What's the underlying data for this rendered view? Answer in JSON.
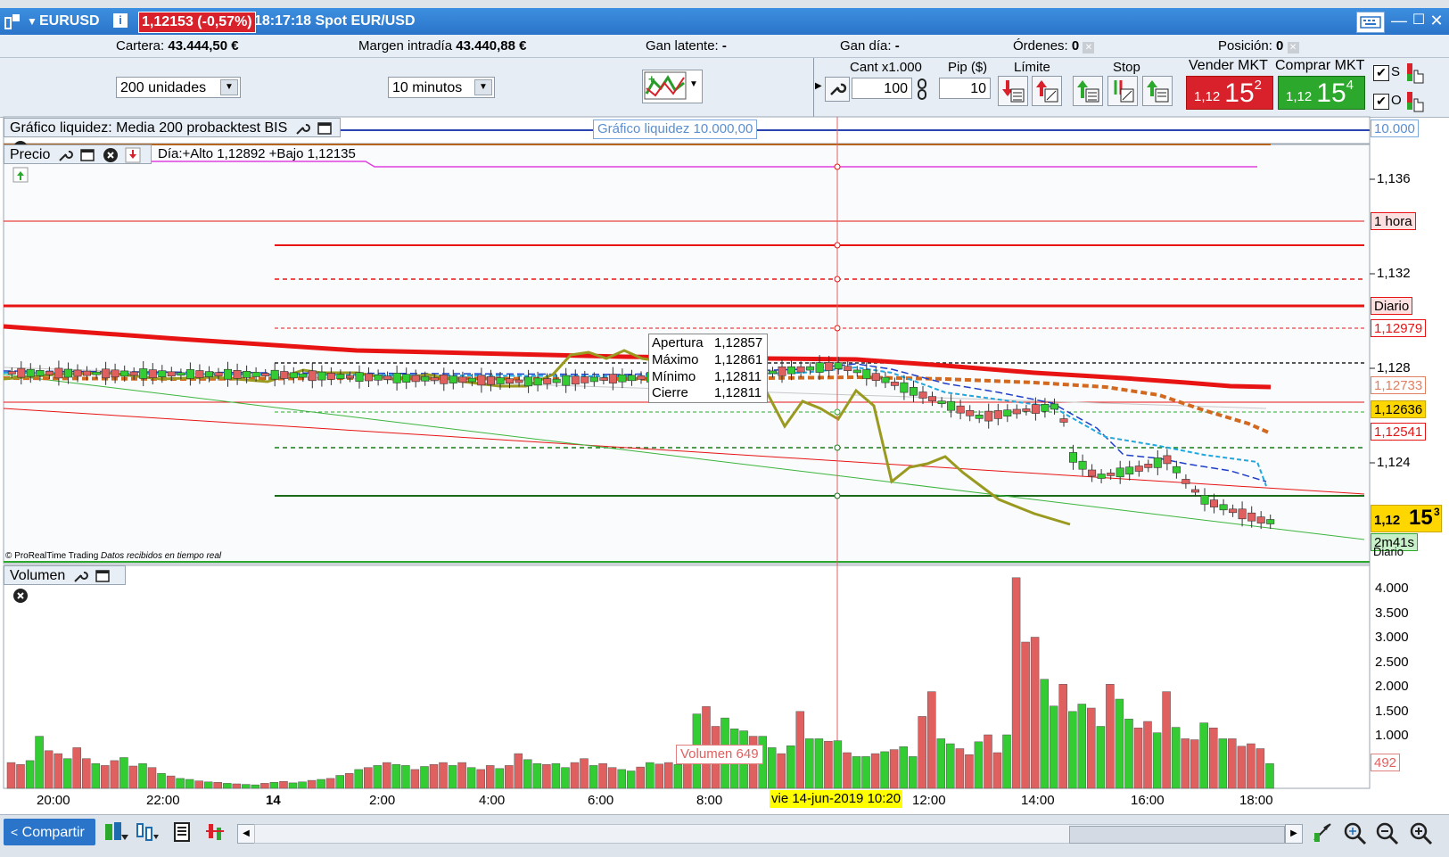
{
  "title_bar": {
    "symbol": "EURUSD",
    "info_icon": "i",
    "price_change": "1,12153 (-0,57%)",
    "time_info": "18:17:18 Spot EUR/USD"
  },
  "account": {
    "cartera_label": "Cartera:",
    "cartera_value": "43.444,50 €",
    "margen_label": "Margen intradía",
    "margen_value": "43.440,88 €",
    "gan_latente_label": "Gan latente:",
    "gan_latente_value": "-",
    "gan_dia_label": "Gan día:",
    "gan_dia_value": "-",
    "ordenes_label": "Órdenes:",
    "ordenes_value": "0",
    "posicion_label": "Posición:",
    "posicion_value": "0"
  },
  "controls": {
    "units_select": "200 unidades",
    "timeframe_select": "10 minutos",
    "cant_label": "Cant x1.000",
    "cant_value": "100",
    "pip_label": "Pip ($)",
    "pip_value": "10",
    "limite_label": "Límite",
    "stop_label": "Stop",
    "vender_label": "Vender MKT",
    "comprar_label": "Comprar MKT",
    "sell_small": "1,12",
    "sell_big": "15",
    "sell_sup": "2",
    "buy_small": "1,12",
    "buy_big": "15",
    "buy_sup": "4",
    "s_label": "S",
    "o_label": "O"
  },
  "liquidity_panel": {
    "title": "Gráfico liquidez: Media 200 probacktest BIS",
    "center_label": "Gráfico liquidez  10.000,00",
    "value_tag": "10.000"
  },
  "price_panel": {
    "title": "Precio",
    "day_info": "Día:+Alto 1,12892 +Bajo 1,12135",
    "credit": "© ProRealTime Trading",
    "credit_italic": "Datos recibidos en tiempo real",
    "y_ticks": [
      "1,136",
      "1,132",
      "1,128",
      "1,124"
    ],
    "tags": {
      "hora": "1 hora",
      "diario": "Diario",
      "p1": "1,12979",
      "p2": "1,12733",
      "p3": "1,12636",
      "p4": "1,12541",
      "current_small": "1,12",
      "current_big": "15",
      "current_sup": "3",
      "countdown": "2m41s",
      "diario2": "Diario"
    },
    "tooltip": {
      "open_label": "Apertura",
      "open": "1,12857",
      "high_label": "Máximo",
      "high": "1,12861",
      "low_label": "Mínimo",
      "low": "1,12811",
      "close_label": "Cierre",
      "close": "1,12811"
    }
  },
  "volume_panel": {
    "title": "Volumen",
    "y_ticks": [
      "4.000",
      "3.500",
      "3.000",
      "2.500",
      "2.000",
      "1.500",
      "1.000"
    ],
    "cursor_label": "Volumen  649",
    "last_tag": "492"
  },
  "x_axis": {
    "labels": [
      "20:00",
      "22:00",
      "14",
      "2:00",
      "4:00",
      "6:00",
      "8:00",
      "12:00",
      "14:00",
      "16:00",
      "18:00"
    ],
    "cursor_date": "vie 14-jun-2019 10:20"
  },
  "bottom": {
    "share": "Compartir"
  },
  "colors": {
    "title_blue": "#2a74c9",
    "sell_red": "#d9212b",
    "buy_green": "#2ca82c",
    "up_candle": "#33cc33",
    "down_candle": "#e06060",
    "ma_red": "#e81414",
    "ma_orange": "#d2691e",
    "olive_line": "#9a9a20"
  },
  "chart_data": [
    {
      "type": "volume-bar",
      "title": "Volumen",
      "ylim": [
        0,
        4300
      ],
      "values": [
        520,
        480,
        560,
        1050,
        760,
        700,
        600,
        820,
        600,
        500,
        460,
        560,
        620,
        450,
        500,
        420,
        300,
        250,
        200,
        180,
        150,
        130,
        120,
        100,
        90,
        80,
        70,
        100,
        120,
        140,
        110,
        130,
        160,
        180,
        200,
        260,
        300,
        380,
        420,
        460,
        520,
        480,
        460,
        380,
        440,
        480,
        520,
        460,
        520,
        420,
        380,
        460,
        400,
        460,
        700,
        580,
        500,
        480,
        500,
        420,
        520,
        600,
        460,
        500,
        420,
        380,
        350,
        430,
        520,
        490,
        520,
        480,
        649,
        1500,
        1650,
        1250,
        1420,
        1200,
        1160,
        1050,
        1050,
        820,
        700,
        860,
        1550,
        1000,
        1000,
        950,
        960,
        720,
        640,
        640,
        700,
        740,
        780,
        840,
        640,
        1450,
        1950,
        1000,
        900,
        800,
        680,
        940,
        1080,
        720,
        1080,
        4250,
        2950,
        3050,
        2200,
        1660,
        2100,
        1550,
        1700,
        1620,
        1250,
        2100,
        1800,
        1400,
        1220,
        1350,
        1120,
        1950,
        1230,
        1000,
        980,
        1320,
        1220,
        1000,
        1000,
        850,
        900,
        800,
        500
      ],
      "up": [
        0,
        0,
        1,
        1,
        0,
        0,
        1,
        0,
        0,
        1,
        0,
        0,
        1,
        0,
        1,
        0,
        1,
        0,
        1,
        1,
        0,
        1,
        0,
        1,
        0,
        1,
        1,
        0,
        1,
        0,
        1,
        1,
        0,
        1,
        0,
        1,
        0,
        1,
        0,
        1,
        0,
        1,
        1,
        0,
        1,
        0,
        0,
        1,
        0,
        1,
        0,
        0,
        1,
        0,
        0,
        1,
        1,
        0,
        1,
        1,
        0,
        0,
        1,
        0,
        0,
        1,
        1,
        0,
        1,
        0,
        0,
        1,
        0,
        1,
        0,
        0,
        1,
        1,
        1,
        0,
        1,
        1,
        0,
        1,
        0,
        1,
        1,
        0,
        1,
        0,
        1,
        1,
        0,
        1,
        0,
        1,
        1,
        0,
        0,
        1,
        1,
        0,
        0,
        1,
        0,
        0,
        1,
        0,
        0,
        0,
        1,
        1,
        0,
        1,
        1,
        0,
        1,
        0,
        1,
        1,
        0,
        0,
        1,
        0,
        1,
        0,
        0,
        1,
        0,
        1,
        0,
        0,
        0,
        0,
        1,
        0
      ]
    }
  ]
}
